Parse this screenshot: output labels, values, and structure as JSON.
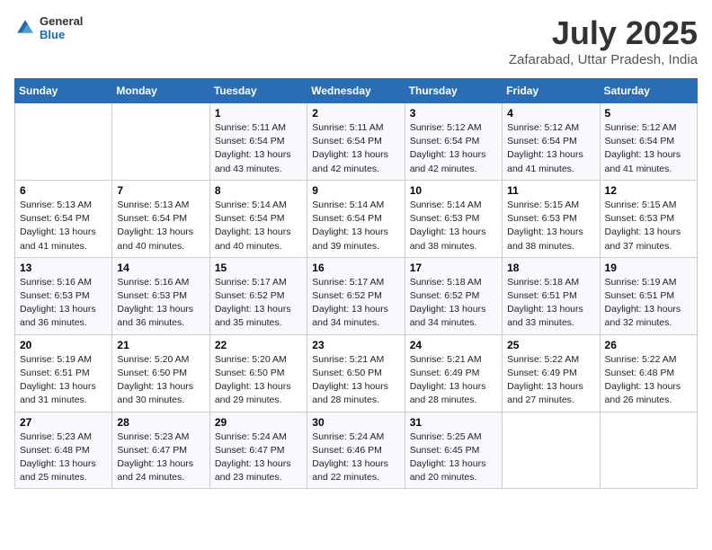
{
  "header": {
    "logo": {
      "general": "General",
      "blue": "Blue"
    },
    "title": "July 2025",
    "subtitle": "Zafarabad, Uttar Pradesh, India"
  },
  "days_of_week": [
    "Sunday",
    "Monday",
    "Tuesday",
    "Wednesday",
    "Thursday",
    "Friday",
    "Saturday"
  ],
  "weeks": [
    [
      {
        "day": "",
        "empty": true
      },
      {
        "day": "",
        "empty": true
      },
      {
        "day": "1",
        "sunrise": "5:11 AM",
        "sunset": "6:54 PM",
        "daylight": "13 hours and 43 minutes."
      },
      {
        "day": "2",
        "sunrise": "5:11 AM",
        "sunset": "6:54 PM",
        "daylight": "13 hours and 42 minutes."
      },
      {
        "day": "3",
        "sunrise": "5:12 AM",
        "sunset": "6:54 PM",
        "daylight": "13 hours and 42 minutes."
      },
      {
        "day": "4",
        "sunrise": "5:12 AM",
        "sunset": "6:54 PM",
        "daylight": "13 hours and 41 minutes."
      },
      {
        "day": "5",
        "sunrise": "5:12 AM",
        "sunset": "6:54 PM",
        "daylight": "13 hours and 41 minutes."
      }
    ],
    [
      {
        "day": "6",
        "sunrise": "5:13 AM",
        "sunset": "6:54 PM",
        "daylight": "13 hours and 41 minutes."
      },
      {
        "day": "7",
        "sunrise": "5:13 AM",
        "sunset": "6:54 PM",
        "daylight": "13 hours and 40 minutes."
      },
      {
        "day": "8",
        "sunrise": "5:14 AM",
        "sunset": "6:54 PM",
        "daylight": "13 hours and 40 minutes."
      },
      {
        "day": "9",
        "sunrise": "5:14 AM",
        "sunset": "6:54 PM",
        "daylight": "13 hours and 39 minutes."
      },
      {
        "day": "10",
        "sunrise": "5:14 AM",
        "sunset": "6:53 PM",
        "daylight": "13 hours and 38 minutes."
      },
      {
        "day": "11",
        "sunrise": "5:15 AM",
        "sunset": "6:53 PM",
        "daylight": "13 hours and 38 minutes."
      },
      {
        "day": "12",
        "sunrise": "5:15 AM",
        "sunset": "6:53 PM",
        "daylight": "13 hours and 37 minutes."
      }
    ],
    [
      {
        "day": "13",
        "sunrise": "5:16 AM",
        "sunset": "6:53 PM",
        "daylight": "13 hours and 36 minutes."
      },
      {
        "day": "14",
        "sunrise": "5:16 AM",
        "sunset": "6:53 PM",
        "daylight": "13 hours and 36 minutes."
      },
      {
        "day": "15",
        "sunrise": "5:17 AM",
        "sunset": "6:52 PM",
        "daylight": "13 hours and 35 minutes."
      },
      {
        "day": "16",
        "sunrise": "5:17 AM",
        "sunset": "6:52 PM",
        "daylight": "13 hours and 34 minutes."
      },
      {
        "day": "17",
        "sunrise": "5:18 AM",
        "sunset": "6:52 PM",
        "daylight": "13 hours and 34 minutes."
      },
      {
        "day": "18",
        "sunrise": "5:18 AM",
        "sunset": "6:51 PM",
        "daylight": "13 hours and 33 minutes."
      },
      {
        "day": "19",
        "sunrise": "5:19 AM",
        "sunset": "6:51 PM",
        "daylight": "13 hours and 32 minutes."
      }
    ],
    [
      {
        "day": "20",
        "sunrise": "5:19 AM",
        "sunset": "6:51 PM",
        "daylight": "13 hours and 31 minutes."
      },
      {
        "day": "21",
        "sunrise": "5:20 AM",
        "sunset": "6:50 PM",
        "daylight": "13 hours and 30 minutes."
      },
      {
        "day": "22",
        "sunrise": "5:20 AM",
        "sunset": "6:50 PM",
        "daylight": "13 hours and 29 minutes."
      },
      {
        "day": "23",
        "sunrise": "5:21 AM",
        "sunset": "6:50 PM",
        "daylight": "13 hours and 28 minutes."
      },
      {
        "day": "24",
        "sunrise": "5:21 AM",
        "sunset": "6:49 PM",
        "daylight": "13 hours and 28 minutes."
      },
      {
        "day": "25",
        "sunrise": "5:22 AM",
        "sunset": "6:49 PM",
        "daylight": "13 hours and 27 minutes."
      },
      {
        "day": "26",
        "sunrise": "5:22 AM",
        "sunset": "6:48 PM",
        "daylight": "13 hours and 26 minutes."
      }
    ],
    [
      {
        "day": "27",
        "sunrise": "5:23 AM",
        "sunset": "6:48 PM",
        "daylight": "13 hours and 25 minutes."
      },
      {
        "day": "28",
        "sunrise": "5:23 AM",
        "sunset": "6:47 PM",
        "daylight": "13 hours and 24 minutes."
      },
      {
        "day": "29",
        "sunrise": "5:24 AM",
        "sunset": "6:47 PM",
        "daylight": "13 hours and 23 minutes."
      },
      {
        "day": "30",
        "sunrise": "5:24 AM",
        "sunset": "6:46 PM",
        "daylight": "13 hours and 22 minutes."
      },
      {
        "day": "31",
        "sunrise": "5:25 AM",
        "sunset": "6:45 PM",
        "daylight": "13 hours and 20 minutes."
      },
      {
        "day": "",
        "empty": true
      },
      {
        "day": "",
        "empty": true
      }
    ]
  ]
}
